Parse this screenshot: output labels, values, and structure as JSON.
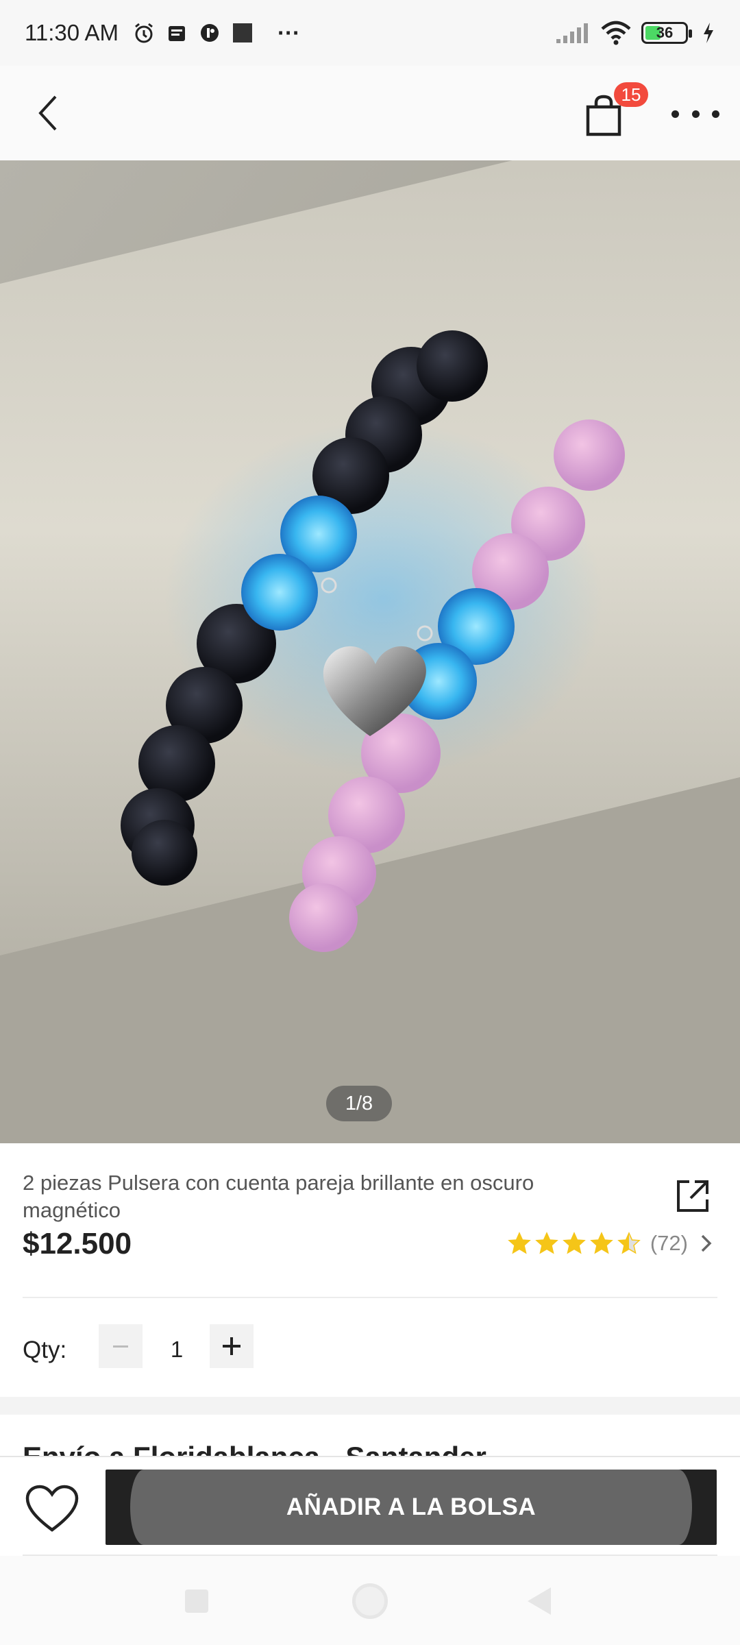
{
  "status_bar": {
    "time": "11:30 AM",
    "more_label": "···",
    "battery_level": 36,
    "battery_label": "36",
    "icons": [
      "alarm-icon",
      "notes-icon",
      "app-icon",
      "square-icon",
      "signal-icon",
      "wifi-icon",
      "battery-icon",
      "charging-icon"
    ]
  },
  "header": {
    "cart_badge": "15",
    "icons": [
      "back-icon",
      "shopping-bag-icon",
      "more-icon"
    ]
  },
  "gallery": {
    "counter": "1/8"
  },
  "product": {
    "title": "2 piezas Pulsera con cuenta pareja brillante en oscuro magnético",
    "price": "$12.500",
    "rating_value": 4.5,
    "rating_max": 5,
    "review_count": "(72)",
    "qty_label": "Qty:",
    "qty_value": "1"
  },
  "shipping": {
    "heading": "Envío a Floridablanca - Santander"
  },
  "bottom_bar": {
    "add_to_bag_label": "AÑADIR A LA BOLSA",
    "icons": [
      "heart-icon"
    ]
  },
  "colors": {
    "badge": "#f24a3d",
    "star": "#f5c518",
    "button": "#222222"
  }
}
